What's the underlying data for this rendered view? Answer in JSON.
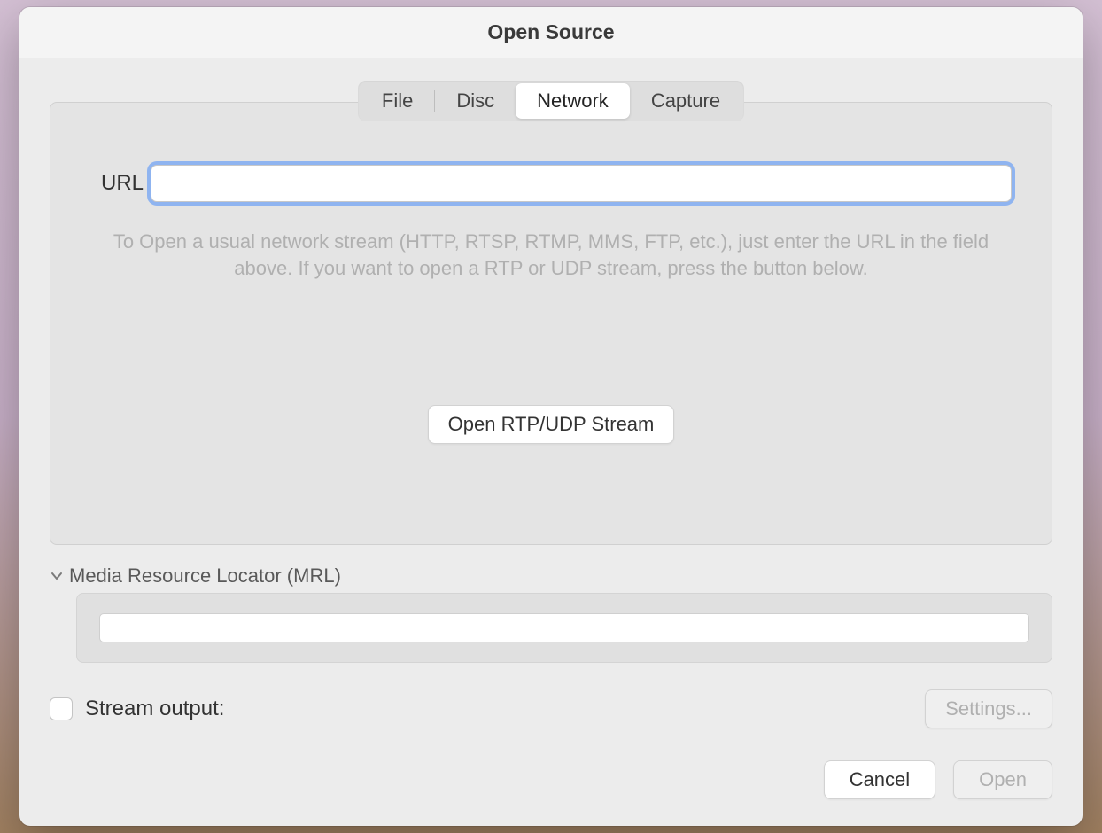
{
  "window": {
    "title": "Open Source"
  },
  "tabs": {
    "file": "File",
    "disc": "Disc",
    "network": "Network",
    "capture": "Capture",
    "active": "network"
  },
  "network": {
    "url_label": "URL",
    "url_value": "",
    "help_text": "To Open a usual network stream (HTTP, RTSP, RTMP, MMS, FTP, etc.), just enter the URL in the field above. If you want to open a RTP or UDP stream, press the button below.",
    "open_rtp_button": "Open RTP/UDP Stream"
  },
  "mrl": {
    "header": "Media Resource Locator (MRL)",
    "value": ""
  },
  "stream_output": {
    "label": "Stream output:",
    "checked": false,
    "settings_button": "Settings..."
  },
  "actions": {
    "cancel": "Cancel",
    "open": "Open"
  }
}
